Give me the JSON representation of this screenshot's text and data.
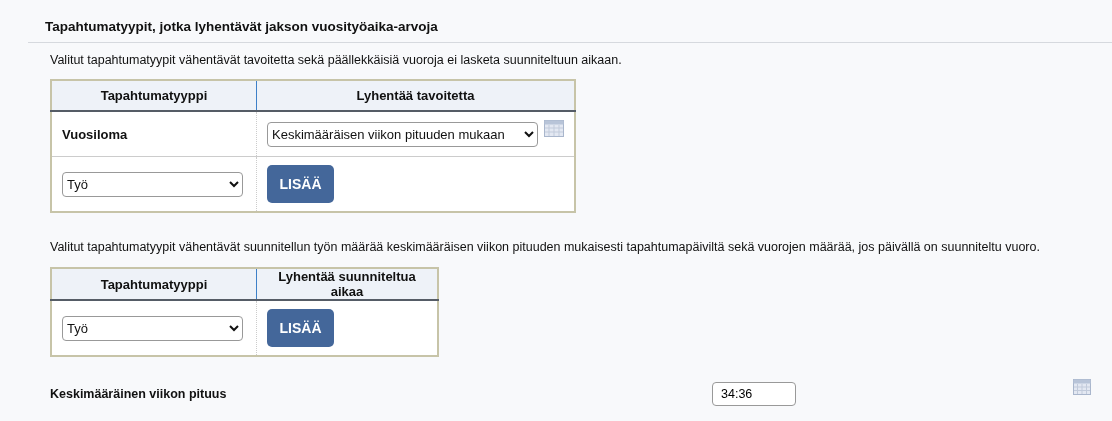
{
  "section": {
    "title": "Tapahtumatyypit, jotka lyhentävät jakson vuosityöaika-arvoja"
  },
  "target_table": {
    "description": "Valitut tapahtumatyypit vähentävät tavoitetta sekä päällekkäisiä vuoroja ei lasketa suunniteltuun aikaan.",
    "columns": [
      "Tapahtumatyyppi",
      "Lyhentää tavoitetta"
    ],
    "rows": [
      {
        "event_type": "Vuosiloma",
        "reduction": "Keskimääräisen viikon pituuden mukaan"
      }
    ],
    "add_row": {
      "event_type": "Työ",
      "button": "LISÄÄ"
    }
  },
  "planned_table": {
    "description": "Valitut tapahtumatyypit vähentävät suunnitellun työn määrää keskimääräisen viikon pituuden mukaisesti tapahtumapäiviltä sekä vuorojen määrää, jos päivällä on suunniteltu vuoro.",
    "columns": [
      "Tapahtumatyyppi",
      "Lyhentää suunniteltua aikaa"
    ],
    "add_row": {
      "event_type": "Työ",
      "button": "LISÄÄ"
    }
  },
  "week_length": {
    "label": "Keskimääräinen viikon pituus",
    "value": "34:36"
  }
}
